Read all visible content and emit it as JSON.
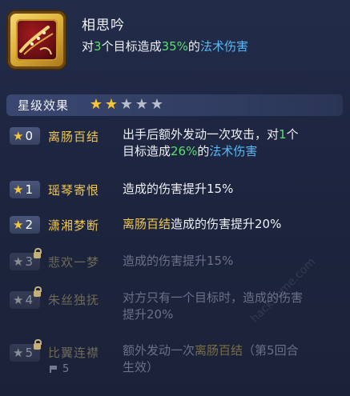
{
  "skill": {
    "name": "相思吟",
    "desc_prefix": "对",
    "desc_targets": "3",
    "desc_mid": "个目标造成",
    "desc_percent": "35%",
    "desc_of": "的",
    "desc_damage": "法术伤害"
  },
  "star_section": {
    "title": "星级效果",
    "stars_filled": 2,
    "stars_total": 5
  },
  "rows": [
    {
      "num": "0",
      "name": "离肠百结",
      "desc_a": "出手后额外发动一次攻击，对",
      "desc_b": "1",
      "desc_c": "个",
      "desc_d": "目标造成",
      "desc_e": "26%",
      "desc_f": "的",
      "desc_g": "法术伤害"
    },
    {
      "num": "1",
      "name": "瑶琴寄恨",
      "desc": "造成的伤害提升15%"
    },
    {
      "num": "2",
      "name": "潇湘梦断",
      "desc_gold": "离肠百结",
      "desc_rest": "造成的伤害提升20%"
    },
    {
      "num": "3",
      "name": "悲欢一梦",
      "desc": "造成的伤害提升15%"
    },
    {
      "num": "4",
      "name": "朱丝独抚",
      "desc": "对方只有一个目标时，造成的伤害提升20%"
    },
    {
      "num": "5",
      "name": "比翼连襟",
      "desc_a": "额外发动一次",
      "desc_gold": "离肠百结",
      "desc_b": "（第5回合生效）",
      "flag_count": "5"
    }
  ],
  "watermark": "hackhome.com"
}
